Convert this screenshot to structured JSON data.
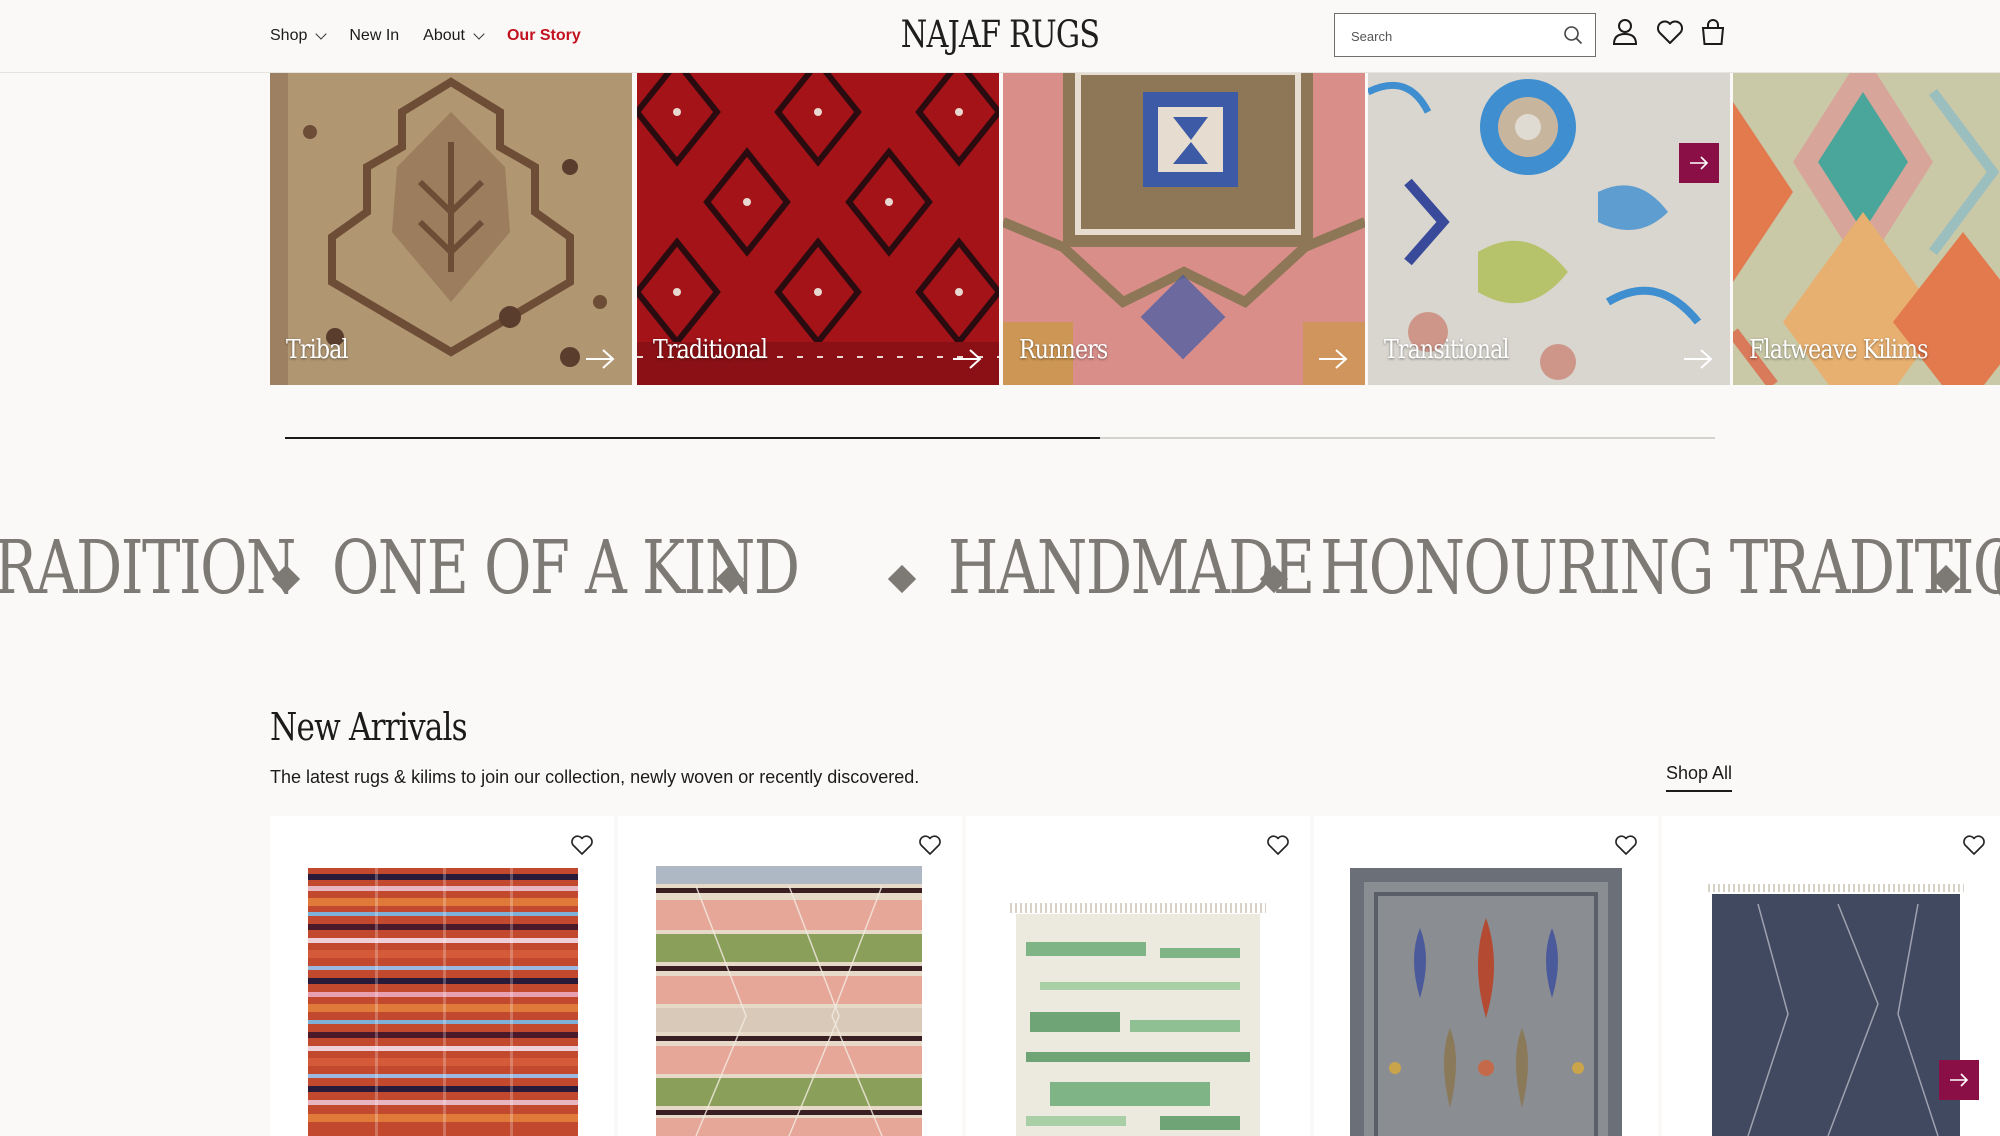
{
  "header": {
    "nav": [
      {
        "label": "Shop",
        "has_dropdown": true
      },
      {
        "label": "New In",
        "has_dropdown": false
      },
      {
        "label": "About",
        "has_dropdown": true
      },
      {
        "label": "Our Story",
        "has_dropdown": false,
        "accent": true
      }
    ],
    "logo": "NAJAF RUGS",
    "search_placeholder": "Search",
    "icons": [
      "account-icon",
      "wishlist-heart-icon",
      "cart-bag-icon"
    ]
  },
  "categories": [
    {
      "label": "Tribal"
    },
    {
      "label": "Traditional"
    },
    {
      "label": "Runners"
    },
    {
      "label": "Transitional"
    },
    {
      "label": "Flatweave Kilims"
    }
  ],
  "carousel_progress": 0.57,
  "marquee": [
    "RADITION",
    "ONE OF A KIND",
    "HANDMADE",
    "HONOURING TRADITION",
    "("
  ],
  "new_arrivals": {
    "title": "New Arrivals",
    "subtitle": "The latest rugs & kilims to join our collection, newly woven or recently discovered.",
    "shop_all": "Shop All"
  },
  "colors": {
    "accent": "#c2121f",
    "button": "#8a0f47",
    "marquee": "#7d7975"
  }
}
